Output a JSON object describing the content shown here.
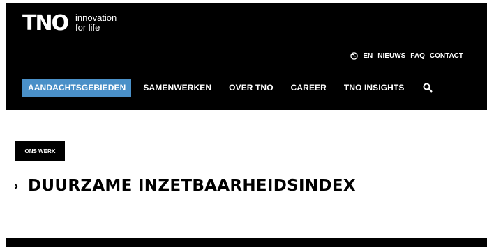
{
  "header": {
    "logo_text": "TNO",
    "tagline_line1": "innovation",
    "tagline_line2": "for life"
  },
  "utility_nav": {
    "globe_icon": "globe-icon",
    "language": "EN",
    "news": "NIEUWS",
    "faq": "FAQ",
    "contact": "CONTACT"
  },
  "main_nav": {
    "items": [
      {
        "label": "AANDACHTSGEBIEDEN",
        "active": true
      },
      {
        "label": "SAMENWERKEN",
        "active": false
      },
      {
        "label": "OVER TNO",
        "active": false
      },
      {
        "label": "CAREER",
        "active": false
      },
      {
        "label": "TNO INSIGHTS",
        "active": false
      }
    ],
    "search_icon": "search-icon",
    "active_color": "#4a90c8"
  },
  "content": {
    "section_tag": "ONS WERK",
    "title_chevron": "›",
    "title": "DUURZAME INZETBAARHEIDSINDEX"
  }
}
